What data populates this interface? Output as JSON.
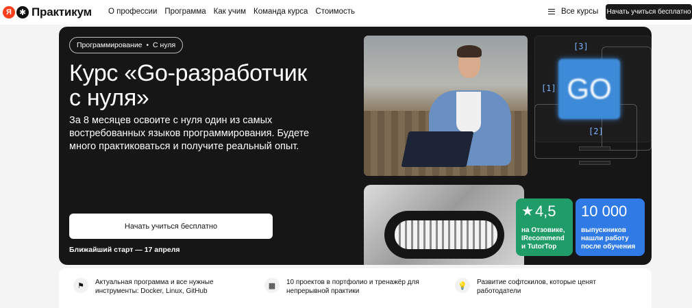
{
  "header": {
    "logo_ya": "Я",
    "logo_text": "Практикум",
    "nav": [
      "О профессии",
      "Программа",
      "Как учим",
      "Команда курса",
      "Стоимость"
    ],
    "all_courses": "Все курсы",
    "cta": "Начать учиться бесплатно"
  },
  "hero": {
    "tag_left": "Программирование",
    "tag_right": "С нуля",
    "title_line1": "Курс «Go-разработчик",
    "title_line2": "с нуля»",
    "subtitle": "За 8 месяцев освоите с нуля один из самых востребованных языков программирования. Будете много практиковаться и получите реальный опыт.",
    "cta": "Начать учиться бесплатно",
    "start": "Ближайший старт — 17 апреля"
  },
  "go_panel": {
    "logo_text": "GO",
    "labels": [
      "[3]",
      "[1]",
      "[2]"
    ]
  },
  "cards": {
    "rating": {
      "value": "4,5",
      "text": "на Отзовике, IRecommend и TutorTop"
    },
    "graduates": {
      "value": "10 000",
      "text": "выпускников нашли работу после обучения"
    }
  },
  "features": [
    {
      "icon": "flag-icon",
      "text": "Актуальная программа и все нужные инструменты: Docker, Linux, GitHub"
    },
    {
      "icon": "grid-icon",
      "text": "10 проектов в портфолио и тренажёр для непрерывной практики"
    },
    {
      "icon": "bulb-icon",
      "text": "Развитие софтскилов, которые ценят работодатели"
    }
  ],
  "colors": {
    "green": "#1f9c68",
    "blue": "#2f7ae5",
    "dark": "#161616",
    "brand_red": "#fc3f1d"
  }
}
